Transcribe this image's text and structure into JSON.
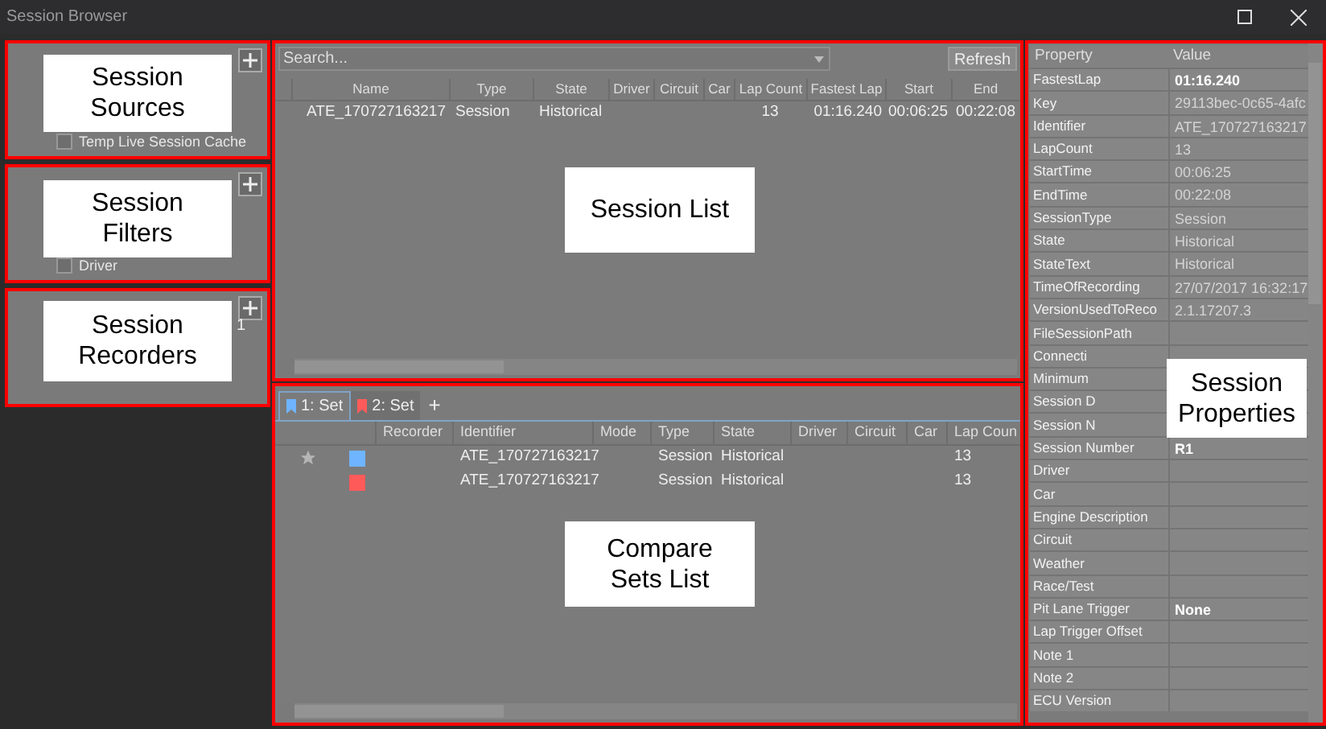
{
  "window": {
    "title": "Session Browser"
  },
  "left_panels": [
    {
      "callout": "Session Sources",
      "items": [
        {
          "label": "Temp Live Session Cache",
          "checked": false
        }
      ]
    },
    {
      "callout": "Session Filters",
      "items": [
        {
          "label": "Driver",
          "checked": false
        }
      ]
    },
    {
      "callout": "Session Recorders",
      "count": "1"
    }
  ],
  "session_list": {
    "callout": "Session List",
    "search": {
      "placeholder": "Search..."
    },
    "refresh": "Refresh",
    "columns": [
      "Name",
      "Type",
      "State",
      "Driver",
      "Circuit",
      "Car",
      "Lap Count",
      "Fastest Lap",
      "Start",
      "End"
    ],
    "rows": [
      [
        "ATE_170727163217",
        "Session",
        "Historical",
        "",
        "",
        "",
        "13",
        "01:16.240",
        "00:06:25",
        "00:22:08"
      ]
    ]
  },
  "compare_sets": {
    "callout": "Compare Sets List",
    "tabs": [
      {
        "label": "1: Set",
        "color": "#6fb4ff",
        "selected": true
      },
      {
        "label": "2: Set",
        "color": "#ff5a5a",
        "selected": false
      }
    ],
    "add": "+",
    "columns": [
      "Recorder",
      "Identifier",
      "Mode",
      "Type",
      "State",
      "Driver",
      "Circuit",
      "Car",
      "Lap Coun"
    ],
    "rows": [
      {
        "starred": true,
        "color": "#6fb4ff",
        "cells": [
          "",
          "ATE_170727163217",
          "",
          "Session",
          "Historical",
          "",
          "",
          "",
          "13"
        ]
      },
      {
        "starred": false,
        "color": "#ff5a5a",
        "cells": [
          "",
          "ATE_170727163217",
          "",
          "Session",
          "Historical",
          "",
          "",
          "",
          "13"
        ]
      }
    ]
  },
  "properties": {
    "callout": "Session Properties",
    "columns": [
      "Property",
      "Value"
    ],
    "rows": [
      {
        "name": "FastestLap",
        "value": "01:16.240",
        "disabled": false
      },
      {
        "name": "Key",
        "value": "29113bec-0c65-4afc",
        "disabled": true
      },
      {
        "name": "Identifier",
        "value": "ATE_170727163217",
        "disabled": true
      },
      {
        "name": "LapCount",
        "value": "13",
        "disabled": true
      },
      {
        "name": "StartTime",
        "value": "00:06:25",
        "disabled": true
      },
      {
        "name": "EndTime",
        "value": "00:22:08",
        "disabled": true
      },
      {
        "name": "SessionType",
        "value": "Session",
        "disabled": true
      },
      {
        "name": "State",
        "value": "Historical",
        "disabled": true
      },
      {
        "name": "StateText",
        "value": "Historical",
        "disabled": true
      },
      {
        "name": "TimeOfRecording",
        "value": "27/07/2017 16:32:17",
        "disabled": true
      },
      {
        "name": "VersionUsedToReco",
        "value": "2.1.17207.3",
        "disabled": true
      },
      {
        "name": "FileSessionPath"
      },
      {
        "name": "Connecti"
      },
      {
        "name": "Minimum"
      },
      {
        "name": "Session D"
      },
      {
        "name": "Session N"
      },
      {
        "name": "Session Number",
        "value": "R1",
        "disabled": false
      },
      {
        "name": "Driver"
      },
      {
        "name": "Car"
      },
      {
        "name": "Engine Description"
      },
      {
        "name": "Circuit"
      },
      {
        "name": "Weather"
      },
      {
        "name": "Race/Test"
      },
      {
        "name": "Pit Lane Trigger",
        "value": "None",
        "disabled": false
      },
      {
        "name": "Lap Trigger Offset"
      },
      {
        "name": "Note 1"
      },
      {
        "name": "Note 2"
      },
      {
        "name": "ECU Version"
      }
    ]
  }
}
